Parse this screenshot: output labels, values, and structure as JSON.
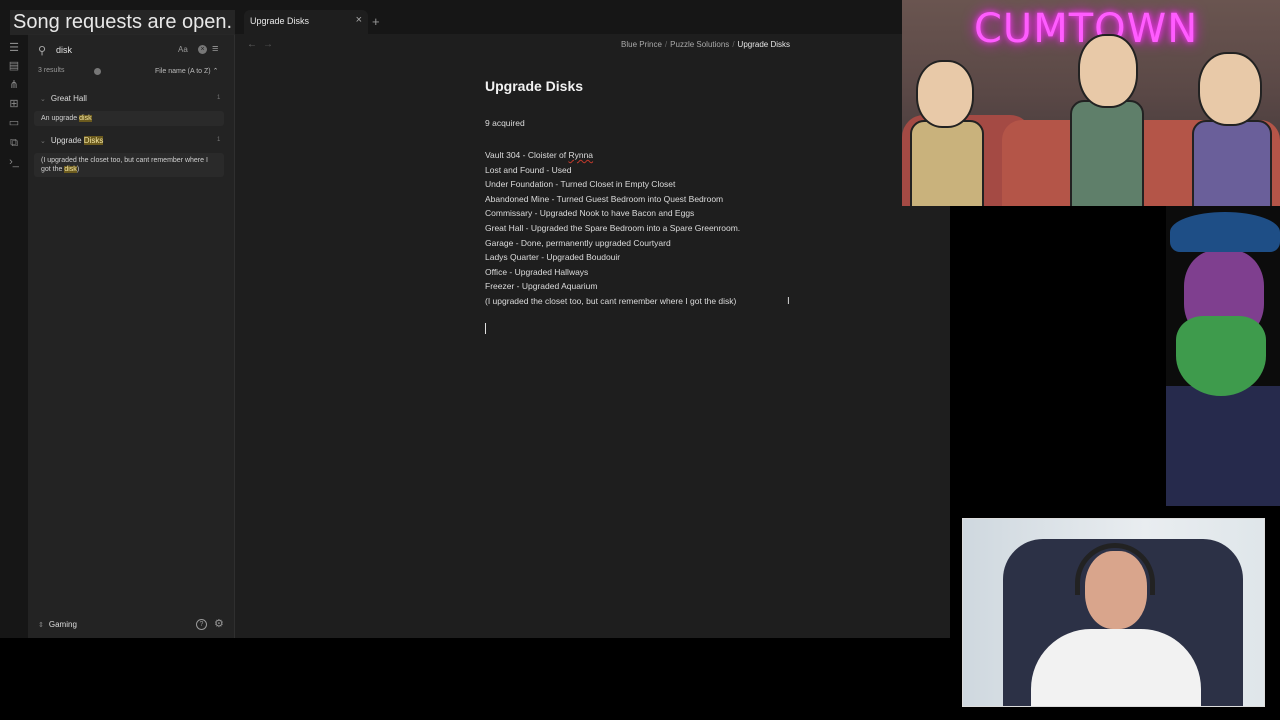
{
  "overlay_text": "Song requests are open.",
  "tab": {
    "title": "Upgrade Disks",
    "close": "×",
    "new": "+"
  },
  "ribbon": {
    "icons": [
      "files-icon",
      "search-icon",
      "graph-icon",
      "canvas-icon",
      "calendar-icon",
      "templates-icon",
      "terminal-icon"
    ]
  },
  "search": {
    "query": "disk",
    "match_case": "Aa",
    "clear": "×",
    "results_count": "3 results",
    "sort": "File name (A to Z)",
    "sort_caret": "⌃",
    "results": [
      {
        "file": "Great Hall",
        "count": "1",
        "matches": [
          {
            "before": "An upgrade ",
            "hit": "disk",
            "after": ""
          }
        ]
      },
      {
        "file_before": "Upgrade ",
        "file_hit": "Disks",
        "count": "1",
        "matches": [
          {
            "before": "(I upgraded the closet too, but cant remember where I got the ",
            "hit": "disk",
            "after": ")"
          }
        ]
      }
    ]
  },
  "vault": {
    "name": "Gaming"
  },
  "breadcrumb": [
    "Blue Prince",
    "Puzzle Solutions",
    "Upgrade Disks"
  ],
  "breadcrumb_sep": "/",
  "document": {
    "title": "Upgrade Disks",
    "acquired": "9 acquired",
    "lines": [
      "Vault 304 - Cloister of Rynna",
      "Lost and Found - Used",
      "Under Foundation - Turned Closet in Empty Closet",
      "Abandoned Mine - Turned Guest Bedroom into Quest Bedroom",
      "Commissary - Upgraded Nook to have Bacon and Eggs",
      "Great Hall - Upgraded the Spare Bedroom into a Spare Greenroom.",
      "Garage - Done, permanently upgraded Courtyard",
      "Ladys Quarter - Upgraded Boudouir",
      "Office - Upgraded Hallways",
      "Freezer - Upgraded Aquarium",
      "(I upgraded the closet too, but cant remember where I got the disk)"
    ],
    "misspelled": "Rynna"
  },
  "stream": {
    "cumtown_sign": "CUMTOWN"
  },
  "colors": {
    "app_bg": "#1e1e1e",
    "sidebar_bg": "#232323",
    "highlight": "#6b5a1e",
    "neon": "#ff5cff"
  }
}
